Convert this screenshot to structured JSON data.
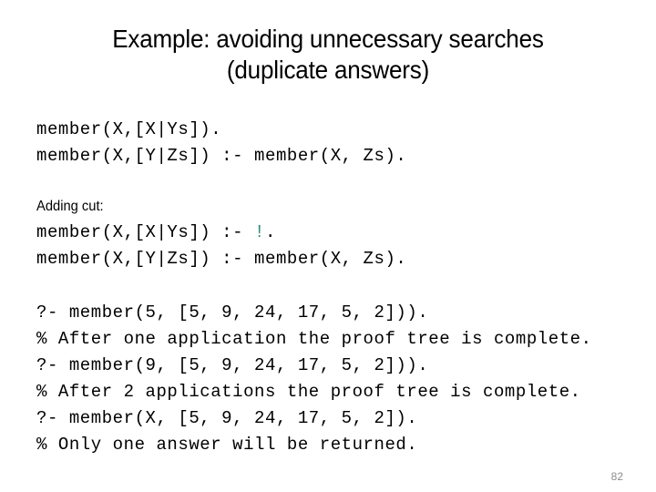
{
  "slide": {
    "title_lines": [
      "Example: avoiding unnecessary searches",
      "(duplicate answers)"
    ],
    "page_number": "82",
    "colors": {
      "background": "#ffffff",
      "text": "#000000",
      "cut_highlight": "#2e8b7b",
      "page_number": "#8c8c8c"
    }
  },
  "block1": {
    "lines": [
      "member(X,[X|Ys]).",
      "member(X,[Y|Zs]) :- member(X, Zs)."
    ]
  },
  "block2": {
    "label": "Adding cut:",
    "line1_before_cut": "member(X,[X|Ys]) :- ",
    "line1_cut": "!",
    "line1_after_cut": ".",
    "line2": "member(X,[Y|Zs]) :- member(X, Zs)."
  },
  "block3": {
    "lines": [
      "?- member(5, [5, 9, 24, 17, 5, 2])).",
      "% After one application the proof tree is complete.",
      "?- member(9, [5, 9, 24, 17, 5, 2])).",
      "% After 2 applications the proof tree is complete.",
      "?- member(X, [5, 9, 24, 17, 5, 2]).",
      "% Only one answer will be returned."
    ]
  }
}
